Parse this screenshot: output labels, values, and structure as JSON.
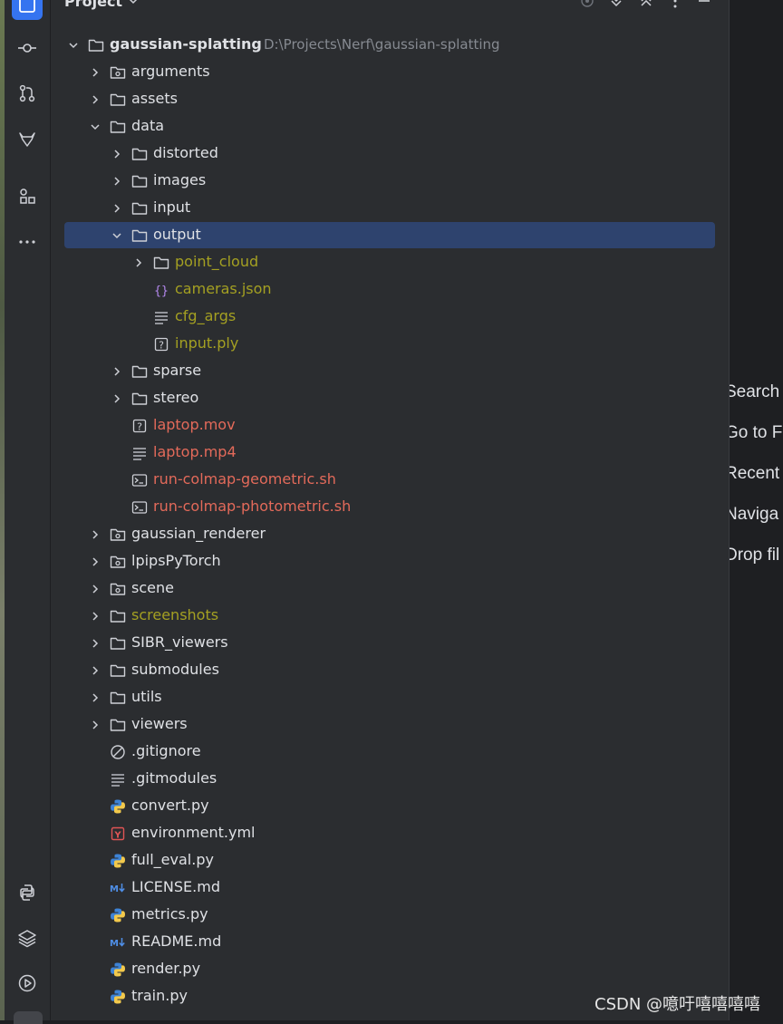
{
  "project_panel": {
    "title": "Project",
    "root": {
      "name": "gaussian-splatting",
      "path": "D:\\Projects\\Nerf\\gaussian-splatting"
    },
    "tree": [
      {
        "name": "arguments",
        "type": "package",
        "depth": 1,
        "expanded": false,
        "status": "normal"
      },
      {
        "name": "assets",
        "type": "folder",
        "depth": 1,
        "expanded": false,
        "status": "normal"
      },
      {
        "name": "data",
        "type": "folder",
        "depth": 1,
        "expanded": true,
        "status": "normal"
      },
      {
        "name": "distorted",
        "type": "folder",
        "depth": 2,
        "expanded": false,
        "status": "normal"
      },
      {
        "name": "images",
        "type": "folder",
        "depth": 2,
        "expanded": false,
        "status": "normal"
      },
      {
        "name": "input",
        "type": "folder",
        "depth": 2,
        "expanded": false,
        "status": "normal"
      },
      {
        "name": "output",
        "type": "folder",
        "depth": 2,
        "expanded": true,
        "status": "normal",
        "selected": true
      },
      {
        "name": "point_cloud",
        "type": "folder",
        "depth": 3,
        "expanded": false,
        "status": "olive"
      },
      {
        "name": "cameras.json",
        "type": "json",
        "depth": 3,
        "status": "olive"
      },
      {
        "name": "cfg_args",
        "type": "text",
        "depth": 3,
        "status": "olive"
      },
      {
        "name": "input.ply",
        "type": "unknown",
        "depth": 3,
        "status": "olive"
      },
      {
        "name": "sparse",
        "type": "folder",
        "depth": 2,
        "expanded": false,
        "status": "normal"
      },
      {
        "name": "stereo",
        "type": "folder",
        "depth": 2,
        "expanded": false,
        "status": "normal"
      },
      {
        "name": "laptop.mov",
        "type": "unknown",
        "depth": 2,
        "status": "red"
      },
      {
        "name": "laptop.mp4",
        "type": "text",
        "depth": 2,
        "status": "red"
      },
      {
        "name": "run-colmap-geometric.sh",
        "type": "shell",
        "depth": 2,
        "status": "red"
      },
      {
        "name": "run-colmap-photometric.sh",
        "type": "shell",
        "depth": 2,
        "status": "red"
      },
      {
        "name": "gaussian_renderer",
        "type": "package",
        "depth": 1,
        "expanded": false,
        "status": "normal"
      },
      {
        "name": "lpipsPyTorch",
        "type": "package",
        "depth": 1,
        "expanded": false,
        "status": "normal"
      },
      {
        "name": "scene",
        "type": "package",
        "depth": 1,
        "expanded": false,
        "status": "normal"
      },
      {
        "name": "screenshots",
        "type": "folder",
        "depth": 1,
        "expanded": false,
        "status": "olive"
      },
      {
        "name": "SIBR_viewers",
        "type": "folder",
        "depth": 1,
        "expanded": false,
        "status": "normal"
      },
      {
        "name": "submodules",
        "type": "folder",
        "depth": 1,
        "expanded": false,
        "status": "normal"
      },
      {
        "name": "utils",
        "type": "folder",
        "depth": 1,
        "expanded": false,
        "status": "normal"
      },
      {
        "name": "viewers",
        "type": "folder",
        "depth": 1,
        "expanded": false,
        "status": "normal"
      },
      {
        "name": ".gitignore",
        "type": "ignore",
        "depth": 1,
        "status": "normal"
      },
      {
        "name": ".gitmodules",
        "type": "text",
        "depth": 1,
        "status": "normal"
      },
      {
        "name": "convert.py",
        "type": "python",
        "depth": 1,
        "status": "normal"
      },
      {
        "name": "environment.yml",
        "type": "yaml",
        "depth": 1,
        "status": "normal"
      },
      {
        "name": "full_eval.py",
        "type": "python",
        "depth": 1,
        "status": "normal"
      },
      {
        "name": "LICENSE.md",
        "type": "markdown",
        "depth": 1,
        "status": "normal"
      },
      {
        "name": "metrics.py",
        "type": "python",
        "depth": 1,
        "status": "normal"
      },
      {
        "name": "README.md",
        "type": "markdown",
        "depth": 1,
        "status": "normal"
      },
      {
        "name": "render.py",
        "type": "python",
        "depth": 1,
        "status": "normal"
      },
      {
        "name": "train.py",
        "type": "python",
        "depth": 1,
        "status": "normal"
      }
    ]
  },
  "welcome_hints": [
    "Search",
    "Go to F",
    "Recent",
    "Naviga",
    "Drop fil"
  ],
  "watermark": "CSDN @噫吁嘻嘻嘻嘻",
  "colors": {
    "selected_row": "#2e436e",
    "olive_status": "#a4a022",
    "red_status": "#e36a5a",
    "accent": "#3574f0"
  }
}
